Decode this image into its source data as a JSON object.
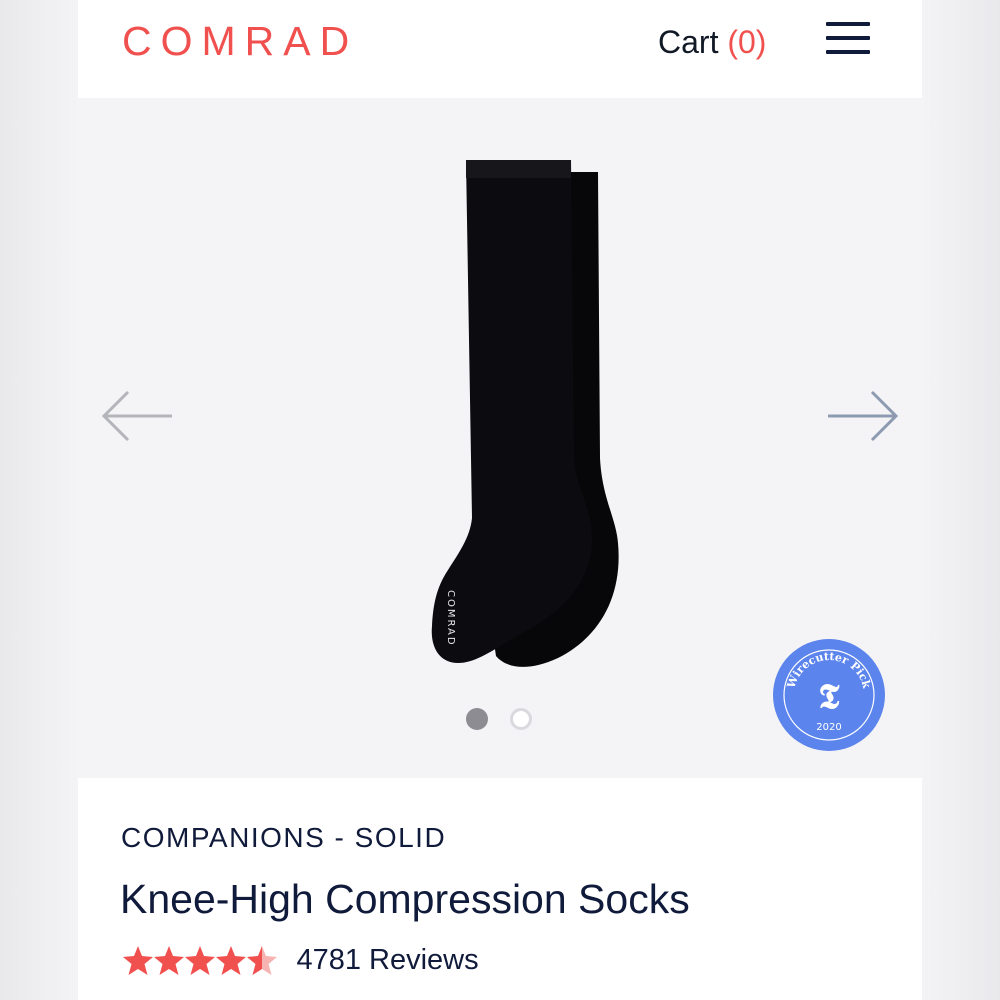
{
  "header": {
    "logo": "COMRAD",
    "cart_label": "Cart",
    "cart_count": "(0)",
    "menu_icon": "hamburger-menu-icon",
    "brand_color": "#f0514f"
  },
  "carousel": {
    "prev_icon": "arrow-left-icon",
    "next_icon": "arrow-right-icon",
    "image": "black-knee-high-sock",
    "sock_logo_text": "COMRAD",
    "slides_total": 2,
    "active_slide": 1,
    "badge": {
      "top_text": "Wirecutter Pick",
      "bottom_text": "2020",
      "color": "#5b84ec"
    }
  },
  "product": {
    "collection": "COMPANIONS - SOLID",
    "title": "Knee-High Compression Socks",
    "rating": 4.5,
    "reviews": "4781 Reviews",
    "star_color": "#f0514f"
  }
}
